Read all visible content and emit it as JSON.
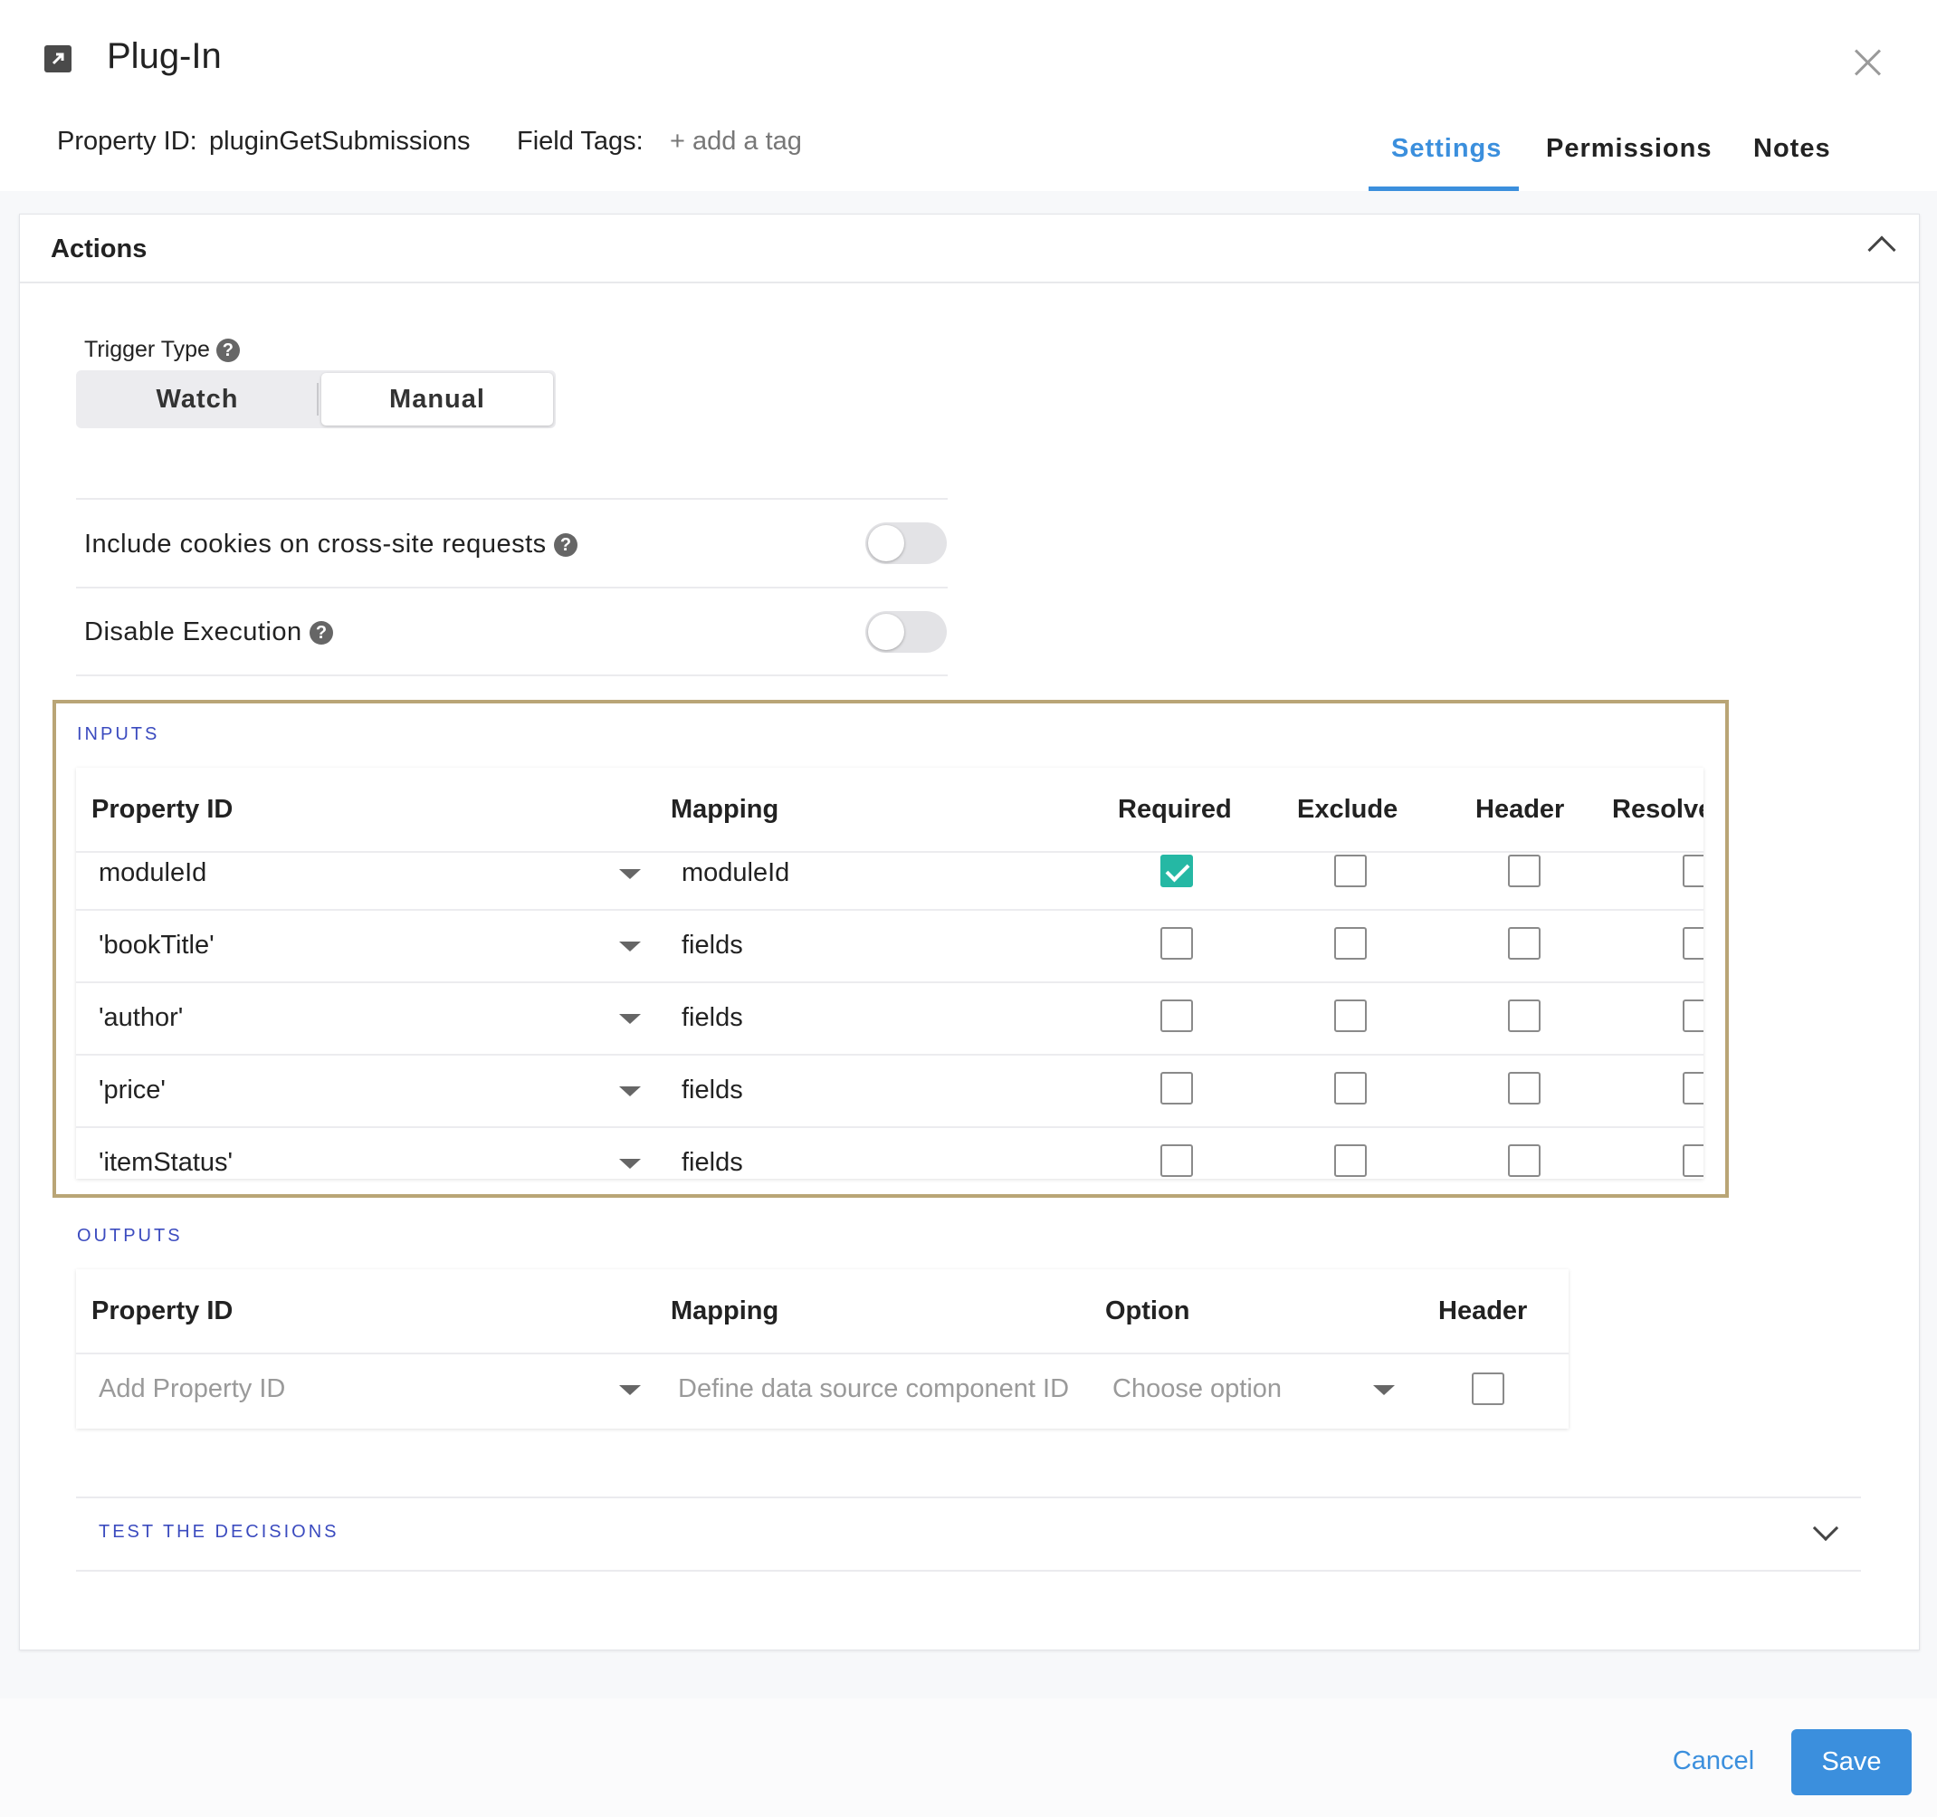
{
  "header": {
    "title": "Plug-In",
    "icon": "external-link-icon",
    "property_id_label": "Property ID:",
    "property_id_value": "pluginGetSubmissions",
    "field_tags_label": "Field Tags:",
    "add_tag": "+ add a tag",
    "tabs": [
      {
        "label": "Settings",
        "active": true
      },
      {
        "label": "Permissions",
        "active": false
      },
      {
        "label": "Notes",
        "active": false
      }
    ]
  },
  "actions": {
    "title": "Actions",
    "trigger_type_label": "Trigger Type",
    "trigger_options": [
      "Watch",
      "Manual"
    ],
    "trigger_selected": "Manual",
    "include_cookies_label": "Include cookies on cross-site requests",
    "include_cookies_on": false,
    "disable_execution_label": "Disable Execution",
    "disable_execution_on": false
  },
  "inputs": {
    "label": "INPUTS",
    "columns": [
      "Property ID",
      "Mapping",
      "Required",
      "Exclude",
      "Header",
      "Resolve"
    ],
    "rows": [
      {
        "property_id": "moduleId",
        "mapping": "moduleId",
        "required": true,
        "exclude": false,
        "header": false,
        "resolve": false
      },
      {
        "property_id": "'bookTitle'",
        "mapping": "fields",
        "required": false,
        "exclude": false,
        "header": false,
        "resolve": false
      },
      {
        "property_id": "'author'",
        "mapping": "fields",
        "required": false,
        "exclude": false,
        "header": false,
        "resolve": false
      },
      {
        "property_id": "'price'",
        "mapping": "fields",
        "required": false,
        "exclude": false,
        "header": false,
        "resolve": false
      },
      {
        "property_id": "'itemStatus'",
        "mapping": "fields",
        "required": false,
        "exclude": false,
        "header": false,
        "resolve": false
      }
    ]
  },
  "outputs": {
    "label": "OUTPUTS",
    "columns": [
      "Property ID",
      "Mapping",
      "Option",
      "Header"
    ],
    "row": {
      "property_id_placeholder": "Add Property ID",
      "mapping_placeholder": "Define data source component ID",
      "option_placeholder": "Choose option",
      "header": false
    }
  },
  "test": {
    "label": "TEST THE DECISIONS"
  },
  "footer": {
    "cancel": "Cancel",
    "save": "Save"
  },
  "colors": {
    "accent": "#3b8fdd",
    "check": "#25b8a4",
    "highlight_border": "#b9a576",
    "section_label": "#3b4bbf"
  }
}
